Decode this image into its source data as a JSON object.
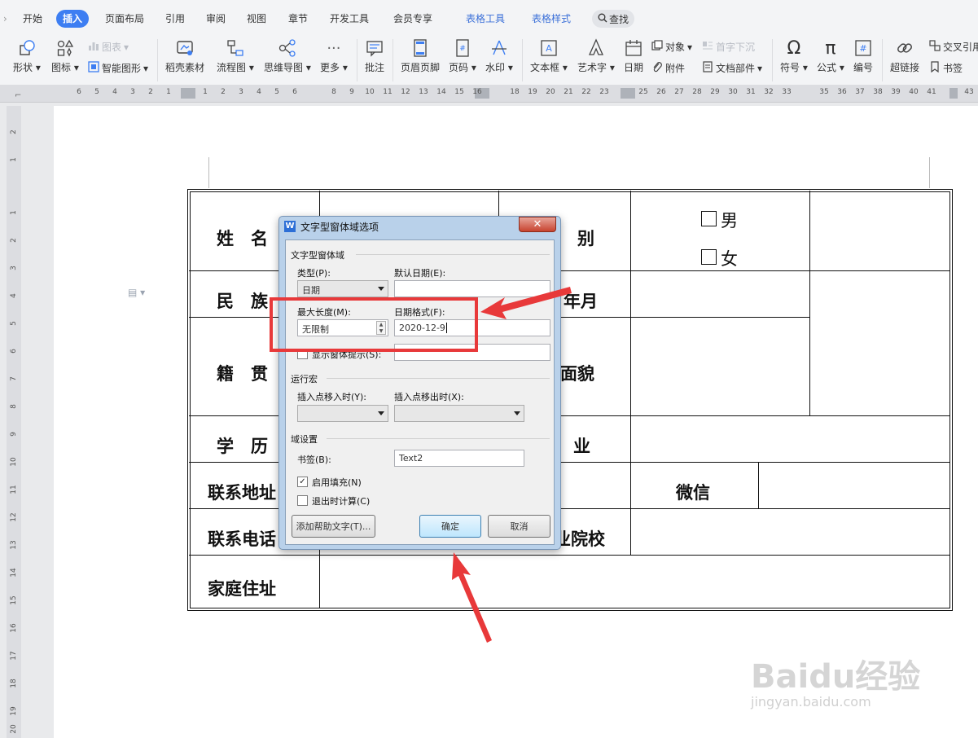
{
  "menu": {
    "items": [
      "开始",
      "插入",
      "页面布局",
      "引用",
      "审阅",
      "视图",
      "章节",
      "开发工具",
      "会员专享"
    ],
    "active": "插入",
    "context_tabs": [
      "表格工具",
      "表格样式"
    ],
    "search": "查找"
  },
  "ribbon": {
    "shape": "形状",
    "icons": "图标",
    "chart": "图表",
    "smart_graphic": "智能图形",
    "docer_material": "稻壳素材",
    "flowchart": "流程图",
    "mindmap": "思维导图",
    "more": "更多",
    "comment": "批注",
    "header_footer": "页眉页脚",
    "page_number": "页码",
    "watermark": "水印",
    "textbox": "文本框",
    "wordart": "艺术字",
    "date": "日期",
    "object": "对象",
    "attachment": "附件",
    "drop_cap": "首字下沉",
    "doc_parts": "文档部件",
    "symbol": "符号",
    "formula": "公式",
    "numbering": "编号",
    "hyperlink": "超链接",
    "cross_ref": "交叉引用",
    "bookmark": "书签"
  },
  "ruler": {
    "h": [
      "6",
      "5",
      "4",
      "3",
      "2",
      "1",
      "1",
      "2",
      "3",
      "4",
      "5",
      "6",
      "8",
      "9",
      "10",
      "11",
      "12",
      "13",
      "14",
      "15",
      "16",
      "18",
      "19",
      "20",
      "21",
      "22",
      "23",
      "25",
      "26",
      "27",
      "28",
      "29",
      "30",
      "31",
      "32",
      "33",
      "35",
      "36",
      "37",
      "38",
      "39",
      "40",
      "41",
      "43"
    ],
    "v": [
      "2",
      "1",
      "1",
      "2",
      "3",
      "4",
      "5",
      "6",
      "7",
      "8",
      "9",
      "10",
      "11",
      "12",
      "13",
      "14",
      "15",
      "16",
      "17",
      "18",
      "19",
      "20"
    ]
  },
  "table": {
    "name": "姓　名",
    "gender": "别",
    "male": "男",
    "female": "女",
    "ethnic": "民　族",
    "birth": "年月",
    "native": "籍　贯",
    "political": "面貌",
    "education": "学　历",
    "major": "业",
    "address": "联系地址",
    "wechat": "微信",
    "phone": "联系电话",
    "school": "业院校",
    "home": "家庭住址"
  },
  "dialog": {
    "title": "文字型窗体域选项",
    "section_field": "文字型窗体域",
    "type_label": "类型(P):",
    "type_value": "日期",
    "default_date_label": "默认日期(E):",
    "default_date_value": "",
    "max_length_label": "最大长度(M):",
    "max_length_value": "无限制",
    "date_format_label": "日期格式(F):",
    "date_format_value": "2020-12-9",
    "show_tip_label": "显示窗体提示(S):",
    "section_macro": "运行宏",
    "entry_label": "插入点移入时(Y):",
    "exit_label": "插入点移出时(X):",
    "section_settings": "域设置",
    "bookmark_label": "书签(B):",
    "bookmark_value": "Text2",
    "enable_fill": "启用填充(N)",
    "enable_fill_checked": true,
    "calc_on_exit": "退出时计算(C)",
    "calc_on_exit_checked": false,
    "help_button": "添加帮助文字(T)...",
    "ok_button": "确定",
    "cancel_button": "取消"
  },
  "watermark": {
    "brand": "Baidu经验",
    "url": "jingyan.baidu.com"
  },
  "colors": {
    "accent": "#3d7ef2",
    "highlight_red": "#e8393a"
  }
}
